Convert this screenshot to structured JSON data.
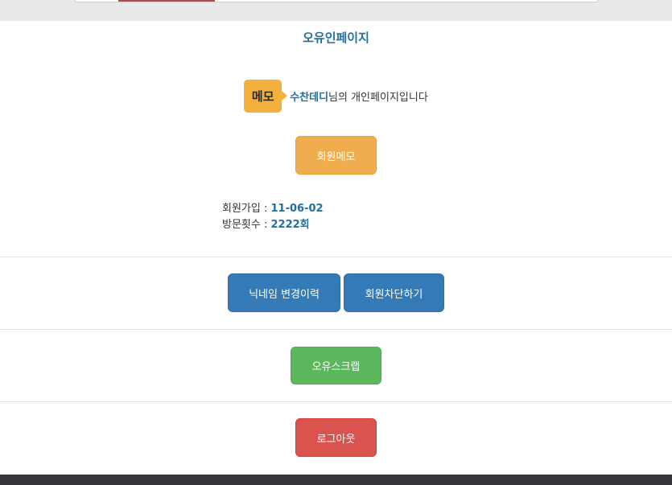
{
  "page": {
    "title": "오유인페이지"
  },
  "profile": {
    "memo_badge": "메모",
    "nickname": "수찬데디",
    "suffix": "님의 개인페이지입니다"
  },
  "actions": {
    "member_memo": "회원메모",
    "nickname_history": "닉네임 변경이력",
    "block_member": "회원차단하기",
    "scrap": "오유스크랩",
    "logout": "로그아웃"
  },
  "stats": {
    "join_label": "회원가입 : ",
    "join_value": "11-06-02",
    "visit_label": "방문횟수 : ",
    "visit_value": "2222회"
  },
  "colors": {
    "accent": "#1f6f9f",
    "orange": "#f0ad4e",
    "blue": "#337ab7",
    "green": "#5cb85c",
    "red": "#d9534f"
  }
}
